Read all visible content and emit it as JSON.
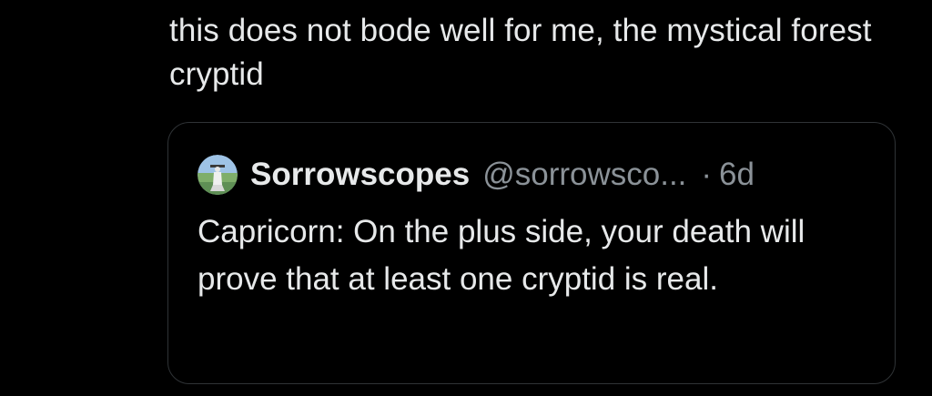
{
  "tweet": {
    "text": "this does not bode well for me, the mystical forest cryptid"
  },
  "quote": {
    "display_name": "Sorrowscopes",
    "handle": "@sorrowsco...",
    "separator": "·",
    "time": "6d",
    "avatar_icon": "landscape-figure-avatar",
    "text": "Capricorn: On the plus side, your death will prove that at least one cryptid is real."
  },
  "colors": {
    "background": "#000000",
    "text_primary": "#e7e9ea",
    "text_secondary": "#8b9298",
    "border": "#2f3336"
  }
}
